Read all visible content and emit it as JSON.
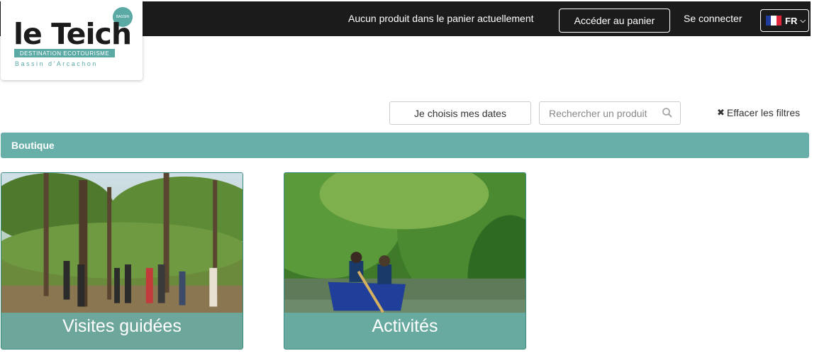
{
  "header": {
    "cart_status": "Aucun produit dans le panier actuellement",
    "cart_button": "Accéder au panier",
    "login": "Se connecter",
    "language": "FR"
  },
  "logo": {
    "name": "le Teich",
    "tagline": "DESTINATION ECOTOURISME",
    "subtitle": "Bassin d'Arcachon",
    "badge": "BASSIN"
  },
  "filters": {
    "dates_button": "Je choisis mes dates",
    "search_placeholder": "Rechercher un produit",
    "clear_label": "Effacer les filtres"
  },
  "breadcrumb": {
    "title": "Boutique"
  },
  "categories": [
    {
      "label": "Visites guidées"
    },
    {
      "label": "Activités"
    }
  ],
  "colors": {
    "accent": "#67afa8",
    "topbar": "#1b1b1b"
  }
}
